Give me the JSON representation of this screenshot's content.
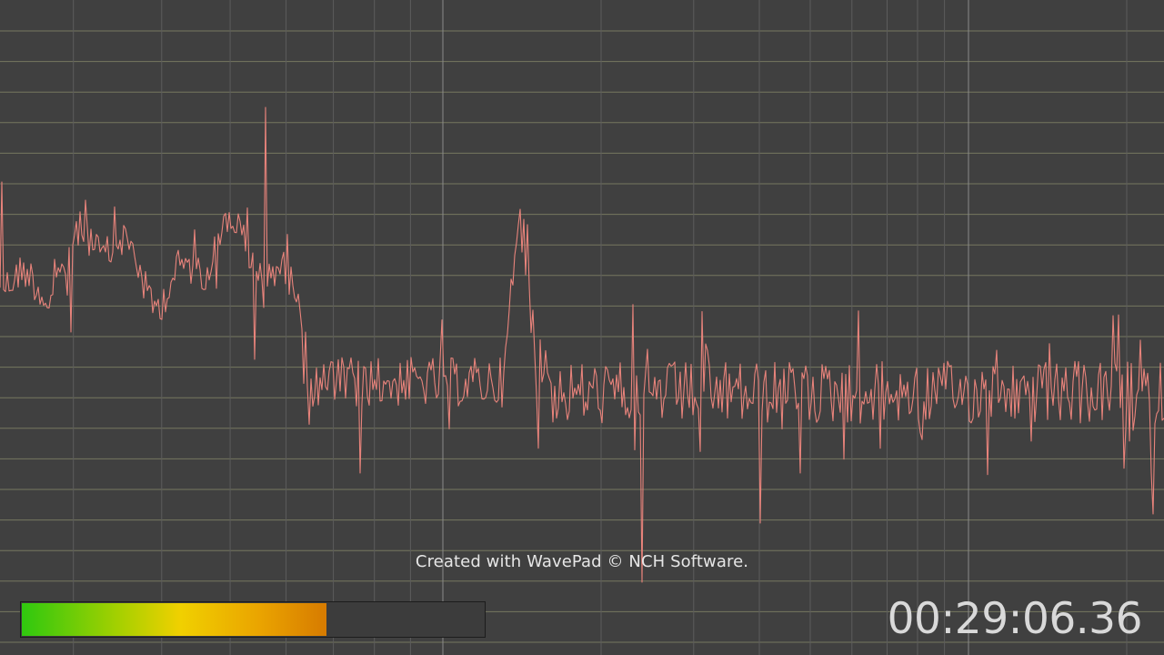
{
  "app": {
    "name": "WavePad",
    "view": "spectrum"
  },
  "watermark": {
    "text": "Created with WavePad © NCH Software."
  },
  "level_meter": {
    "level_fraction": 0.66
  },
  "time_display": {
    "value": "00:29:06.36"
  },
  "colors": {
    "background": "#404040",
    "trace": "#e8837b",
    "grid_horizontal": "#76775f",
    "grid_vertical": "#5c5c5c",
    "grid_vertical_major": "#8a8a8a",
    "text": "#e6e6e6"
  }
}
